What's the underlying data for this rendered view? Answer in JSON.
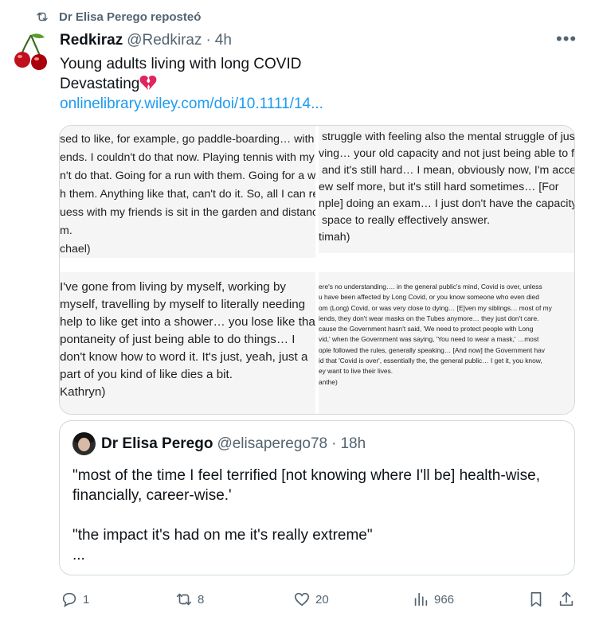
{
  "repost": {
    "icon": "repost-icon",
    "text": "Dr Elisa Perego reposteó"
  },
  "post": {
    "author_name": "Redkiraz",
    "handle": "@Redkiraz",
    "separator": "·",
    "time": "4h",
    "avatar_icon": "cherry-icon",
    "more_icon": "more-icon",
    "more_label": "•••",
    "text_line1": "Young adults living with long COVID",
    "text_line2": "Devastating",
    "emoji_icon": "broken-heart-icon",
    "link": "onlinelibrary.wiley.com/doi/10.1111/14..."
  },
  "media": {
    "quote1": "sed to like, for example, go paddle-boarding… with m\nends. I couldn't do that now. Playing tennis with my f\nn't do that. Going for a run with them. Going for a w\nh them. Anything like that, can't do it. So, all I can re\nuess with my friends is sit in the garden and distanc\nm.\nchael)",
    "quote2": " struggle with feeling also the mental struggle of just\nving… your old capacity and not just being able to ful\n and it's still hard… I mean, obviously now, I'm accept\new self more, but it's still hard sometimes… [For\nnple] doing an exam… I just don't have the capacity o\n space to really effectively answer.\ntimah)",
    "quote3": "I've gone from living by myself, working by\nmyself, travelling by myself to literally needing\nhelp to like get into a shower… you lose like that\npontaneity of just being able to do things… I\ndon't know how to word it. It's just, yeah, just a\npart of you kind of like dies a bit.\nKathryn)",
    "quote4": "ere's no understanding…. in the general public's mind, Covid is over, unless\nu have been affected by Long Covid, or you know someone who even died\nom (Long) Covid, or was very close to dying… [E]ven my siblings… most of my\niends, they don't wear masks on the Tubes anymore… they just don't care.\ncause the Government hasn't said, 'We need to protect people with Long\nvid,' when the Government was saying, 'You need to wear a mask,' …most\nople followed the rules, generally speaking… [And now] the Government hav\nid that 'Covid is over', essentially the, the general public… I get it, you know,\ney want to live their lives.\nanthe)"
  },
  "quoted": {
    "author_name": "Dr Elisa Perego",
    "handle": "@elisaperego78",
    "separator": "·",
    "time": "18h",
    "line1": "\"most of the time I feel terrified [not knowing where I'll be] health-wise,",
    "line2": "financially, career-wise.'",
    "line3": "\"the impact it's had on me it's really extreme\"",
    "line4": "..."
  },
  "actions": {
    "reply_icon": "reply-icon",
    "reply_count": "1",
    "repost_icon": "repost-icon",
    "repost_count": "8",
    "like_icon": "heart-icon",
    "like_count": "20",
    "views_icon": "views-icon",
    "views_count": "966",
    "bookmark_icon": "bookmark-icon",
    "share_icon": "share-icon"
  },
  "colors": {
    "link": "#1d9bf0",
    "secondary_text": "#536471",
    "border": "#cfd9de",
    "broken_heart": "#e0245e"
  }
}
